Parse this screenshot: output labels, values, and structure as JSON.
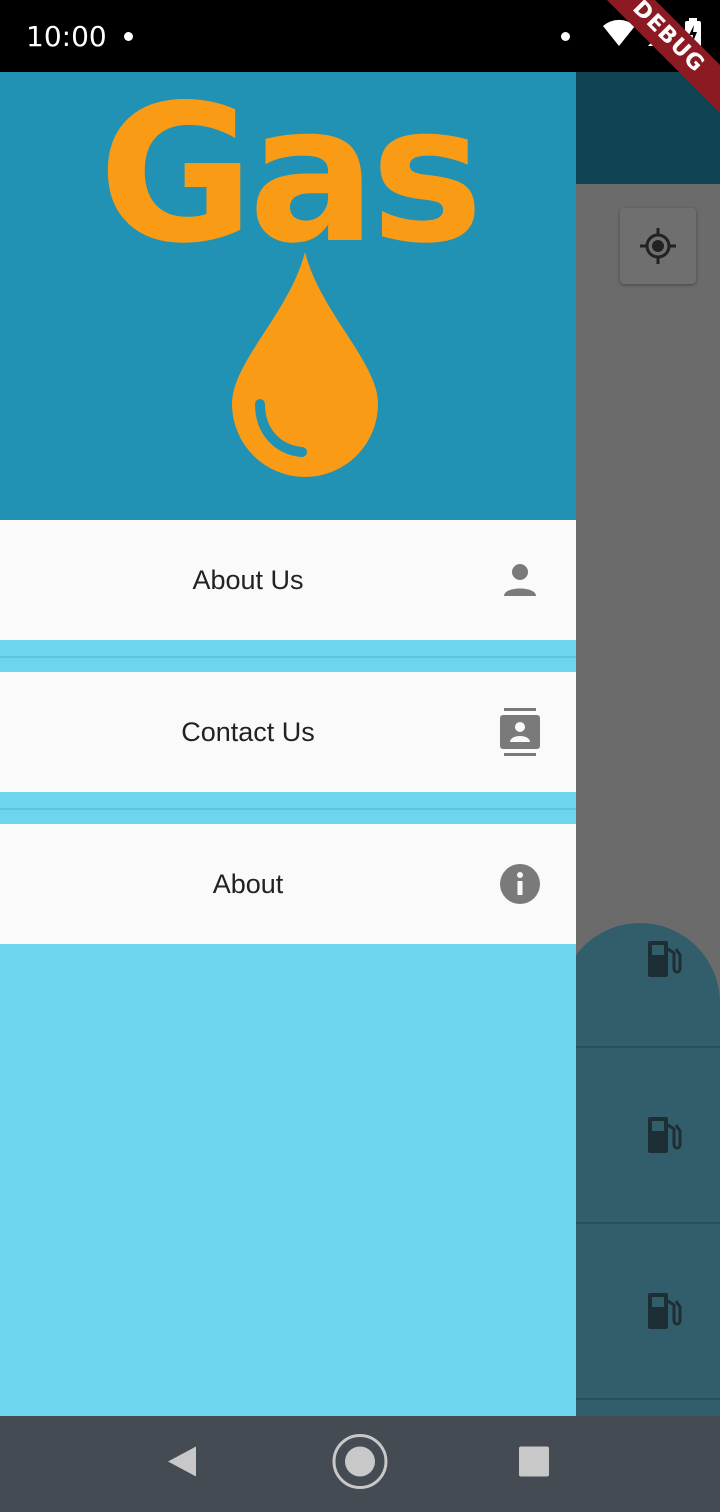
{
  "status_bar": {
    "time": "10:00",
    "debug_label": "DEBUG"
  },
  "drawer": {
    "logo_text": "Gas",
    "items": [
      {
        "label": "About Us",
        "icon": "person-icon"
      },
      {
        "label": "Contact Us",
        "icon": "contacts-icon"
      },
      {
        "label": "About",
        "icon": "info-icon"
      }
    ]
  },
  "colors": {
    "header": "#2192b3",
    "accent": "#fa9b16",
    "drawer_bg": "#6dd5ed",
    "item_bg": "#fafafa",
    "app_bar": "#0f4553"
  }
}
